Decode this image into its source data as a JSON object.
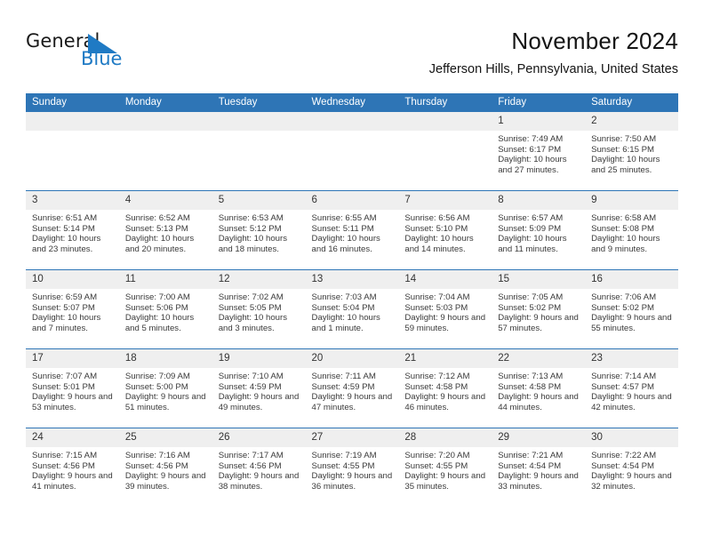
{
  "brand": {
    "word1": "General",
    "word2": "Blue",
    "triangle_color": "#1f7ac4"
  },
  "header": {
    "title": "November 2024",
    "subtitle": "Jefferson Hills, Pennsylvania, United States"
  },
  "theme": {
    "header_blue": "#2e75b6",
    "daynum_bg": "#efefef",
    "text": "#3a3a3a"
  },
  "weekdays": [
    "Sunday",
    "Monday",
    "Tuesday",
    "Wednesday",
    "Thursday",
    "Friday",
    "Saturday"
  ],
  "labels": {
    "sunrise_prefix": "Sunrise:",
    "sunset_prefix": "Sunset:",
    "daylight_prefix": "Daylight:"
  },
  "weeks": [
    [
      {
        "day": "",
        "empty": true
      },
      {
        "day": "",
        "empty": true
      },
      {
        "day": "",
        "empty": true
      },
      {
        "day": "",
        "empty": true
      },
      {
        "day": "",
        "empty": true
      },
      {
        "day": "1",
        "sunrise": "Sunrise: 7:49 AM",
        "sunset": "Sunset: 6:17 PM",
        "daylight": "Daylight: 10 hours and 27 minutes."
      },
      {
        "day": "2",
        "sunrise": "Sunrise: 7:50 AM",
        "sunset": "Sunset: 6:15 PM",
        "daylight": "Daylight: 10 hours and 25 minutes."
      }
    ],
    [
      {
        "day": "3",
        "sunrise": "Sunrise: 6:51 AM",
        "sunset": "Sunset: 5:14 PM",
        "daylight": "Daylight: 10 hours and 23 minutes."
      },
      {
        "day": "4",
        "sunrise": "Sunrise: 6:52 AM",
        "sunset": "Sunset: 5:13 PM",
        "daylight": "Daylight: 10 hours and 20 minutes."
      },
      {
        "day": "5",
        "sunrise": "Sunrise: 6:53 AM",
        "sunset": "Sunset: 5:12 PM",
        "daylight": "Daylight: 10 hours and 18 minutes."
      },
      {
        "day": "6",
        "sunrise": "Sunrise: 6:55 AM",
        "sunset": "Sunset: 5:11 PM",
        "daylight": "Daylight: 10 hours and 16 minutes."
      },
      {
        "day": "7",
        "sunrise": "Sunrise: 6:56 AM",
        "sunset": "Sunset: 5:10 PM",
        "daylight": "Daylight: 10 hours and 14 minutes."
      },
      {
        "day": "8",
        "sunrise": "Sunrise: 6:57 AM",
        "sunset": "Sunset: 5:09 PM",
        "daylight": "Daylight: 10 hours and 11 minutes."
      },
      {
        "day": "9",
        "sunrise": "Sunrise: 6:58 AM",
        "sunset": "Sunset: 5:08 PM",
        "daylight": "Daylight: 10 hours and 9 minutes."
      }
    ],
    [
      {
        "day": "10",
        "sunrise": "Sunrise: 6:59 AM",
        "sunset": "Sunset: 5:07 PM",
        "daylight": "Daylight: 10 hours and 7 minutes."
      },
      {
        "day": "11",
        "sunrise": "Sunrise: 7:00 AM",
        "sunset": "Sunset: 5:06 PM",
        "daylight": "Daylight: 10 hours and 5 minutes."
      },
      {
        "day": "12",
        "sunrise": "Sunrise: 7:02 AM",
        "sunset": "Sunset: 5:05 PM",
        "daylight": "Daylight: 10 hours and 3 minutes."
      },
      {
        "day": "13",
        "sunrise": "Sunrise: 7:03 AM",
        "sunset": "Sunset: 5:04 PM",
        "daylight": "Daylight: 10 hours and 1 minute."
      },
      {
        "day": "14",
        "sunrise": "Sunrise: 7:04 AM",
        "sunset": "Sunset: 5:03 PM",
        "daylight": "Daylight: 9 hours and 59 minutes."
      },
      {
        "day": "15",
        "sunrise": "Sunrise: 7:05 AM",
        "sunset": "Sunset: 5:02 PM",
        "daylight": "Daylight: 9 hours and 57 minutes."
      },
      {
        "day": "16",
        "sunrise": "Sunrise: 7:06 AM",
        "sunset": "Sunset: 5:02 PM",
        "daylight": "Daylight: 9 hours and 55 minutes."
      }
    ],
    [
      {
        "day": "17",
        "sunrise": "Sunrise: 7:07 AM",
        "sunset": "Sunset: 5:01 PM",
        "daylight": "Daylight: 9 hours and 53 minutes."
      },
      {
        "day": "18",
        "sunrise": "Sunrise: 7:09 AM",
        "sunset": "Sunset: 5:00 PM",
        "daylight": "Daylight: 9 hours and 51 minutes."
      },
      {
        "day": "19",
        "sunrise": "Sunrise: 7:10 AM",
        "sunset": "Sunset: 4:59 PM",
        "daylight": "Daylight: 9 hours and 49 minutes."
      },
      {
        "day": "20",
        "sunrise": "Sunrise: 7:11 AM",
        "sunset": "Sunset: 4:59 PM",
        "daylight": "Daylight: 9 hours and 47 minutes."
      },
      {
        "day": "21",
        "sunrise": "Sunrise: 7:12 AM",
        "sunset": "Sunset: 4:58 PM",
        "daylight": "Daylight: 9 hours and 46 minutes."
      },
      {
        "day": "22",
        "sunrise": "Sunrise: 7:13 AM",
        "sunset": "Sunset: 4:58 PM",
        "daylight": "Daylight: 9 hours and 44 minutes."
      },
      {
        "day": "23",
        "sunrise": "Sunrise: 7:14 AM",
        "sunset": "Sunset: 4:57 PM",
        "daylight": "Daylight: 9 hours and 42 minutes."
      }
    ],
    [
      {
        "day": "24",
        "sunrise": "Sunrise: 7:15 AM",
        "sunset": "Sunset: 4:56 PM",
        "daylight": "Daylight: 9 hours and 41 minutes."
      },
      {
        "day": "25",
        "sunrise": "Sunrise: 7:16 AM",
        "sunset": "Sunset: 4:56 PM",
        "daylight": "Daylight: 9 hours and 39 minutes."
      },
      {
        "day": "26",
        "sunrise": "Sunrise: 7:17 AM",
        "sunset": "Sunset: 4:56 PM",
        "daylight": "Daylight: 9 hours and 38 minutes."
      },
      {
        "day": "27",
        "sunrise": "Sunrise: 7:19 AM",
        "sunset": "Sunset: 4:55 PM",
        "daylight": "Daylight: 9 hours and 36 minutes."
      },
      {
        "day": "28",
        "sunrise": "Sunrise: 7:20 AM",
        "sunset": "Sunset: 4:55 PM",
        "daylight": "Daylight: 9 hours and 35 minutes."
      },
      {
        "day": "29",
        "sunrise": "Sunrise: 7:21 AM",
        "sunset": "Sunset: 4:54 PM",
        "daylight": "Daylight: 9 hours and 33 minutes."
      },
      {
        "day": "30",
        "sunrise": "Sunrise: 7:22 AM",
        "sunset": "Sunset: 4:54 PM",
        "daylight": "Daylight: 9 hours and 32 minutes."
      }
    ]
  ]
}
